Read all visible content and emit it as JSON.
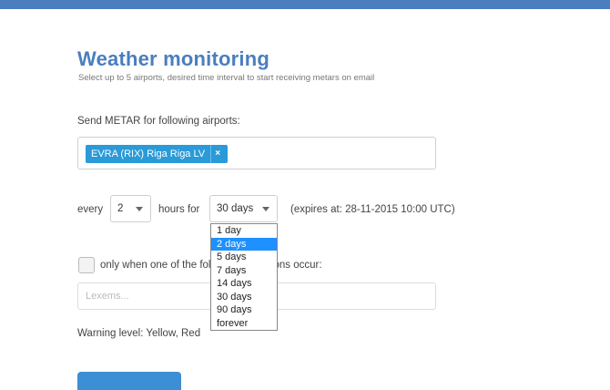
{
  "header": {
    "title": "Weather monitoring",
    "subtitle": "Select up to 5 airports, desired time interval to start receiving metars on email"
  },
  "airports": {
    "label": "Send METAR for following airports:",
    "tags": [
      {
        "label": "EVRA (RIX) Riga Riga LV",
        "remove": "×"
      }
    ]
  },
  "schedule": {
    "every_label": "every",
    "every_value": "2",
    "hours_for_label": "hours for",
    "duration_value": "30 days",
    "expires": "(expires at: 28-11-2015 10:00 UTC)",
    "duration_options": [
      "1 day",
      "2 days",
      "5 days",
      "7 days",
      "14 days",
      "30 days",
      "90 days",
      "forever"
    ],
    "highlighted_option": "2 days"
  },
  "conditions": {
    "label": "only when one of the following conditions occur:",
    "lexems_placeholder": "Lexems..."
  },
  "warning": "Warning level: Yellow, Red",
  "colors": {
    "accent": "#4a7ebf",
    "tag": "#2a9ad8",
    "highlight": "#1e90ff"
  }
}
